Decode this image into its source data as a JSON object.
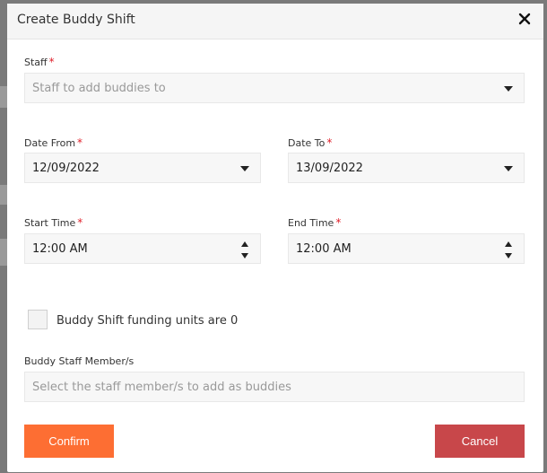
{
  "dialog": {
    "title": "Create Buddy Shift",
    "close_icon": "close-icon"
  },
  "form": {
    "staff": {
      "label": "Staff",
      "required": "*",
      "placeholder": "Staff to add buddies to"
    },
    "date_from": {
      "label": "Date From",
      "required": "*",
      "value": "12/09/2022"
    },
    "date_to": {
      "label": "Date To",
      "required": "*",
      "value": "13/09/2022"
    },
    "start_time": {
      "label": "Start Time",
      "required": "*",
      "value": "12:00 AM"
    },
    "end_time": {
      "label": "End Time",
      "required": "*",
      "value": "12:00 AM"
    },
    "funding_checkbox": {
      "label": "Buddy Shift funding units are 0",
      "checked": false
    },
    "buddy_staff": {
      "label": "Buddy Staff Member/s",
      "placeholder": "Select the staff member/s to add as buddies"
    }
  },
  "actions": {
    "confirm_label": "Confirm",
    "cancel_label": "Cancel"
  },
  "colors": {
    "confirm": "#fd6e33",
    "cancel": "#c8474a",
    "required": "#e0202a"
  }
}
